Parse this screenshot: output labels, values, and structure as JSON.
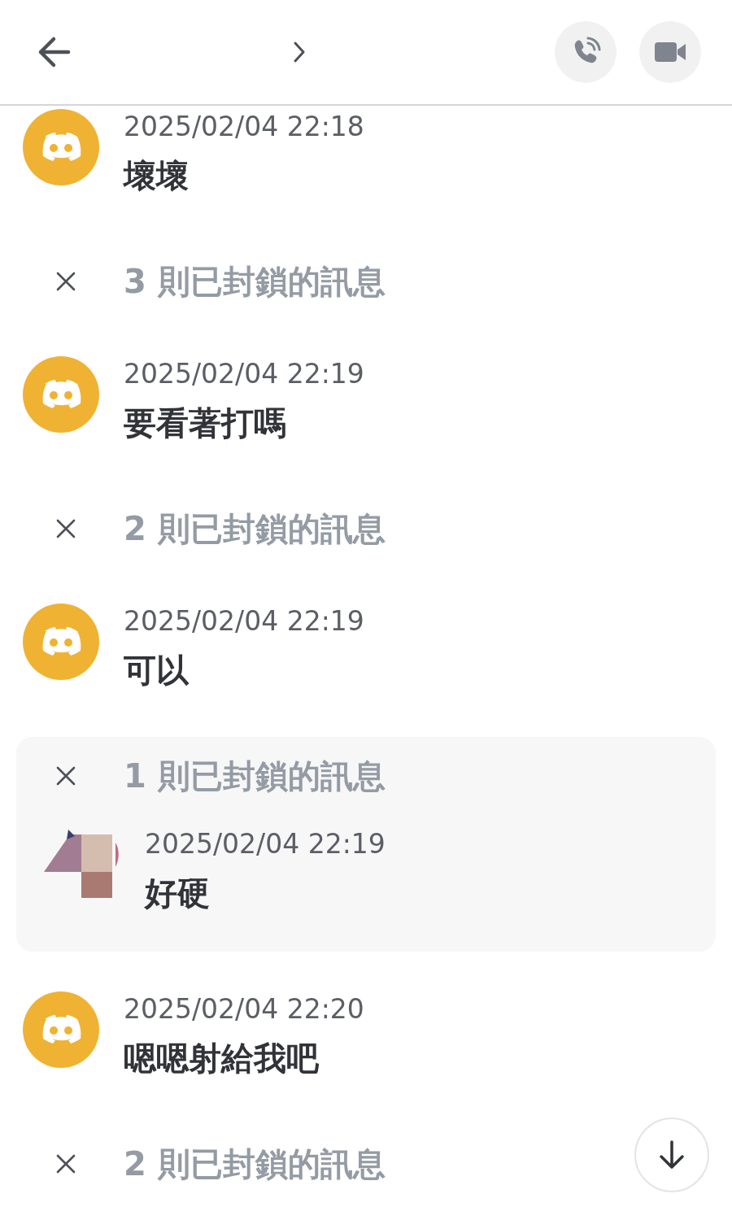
{
  "items": [
    {
      "kind": "message",
      "avatar": {
        "kind": "default"
      },
      "time": "2025/02/04 22:18",
      "text": "壞壞"
    },
    {
      "kind": "blocked",
      "label": "3 則已封鎖的訊息",
      "expanded": false
    },
    {
      "kind": "message",
      "avatar": {
        "kind": "default"
      },
      "time": "2025/02/04 22:19",
      "text": "要看著打嗎"
    },
    {
      "kind": "blocked",
      "label": "2 則已封鎖的訊息",
      "expanded": false
    },
    {
      "kind": "message",
      "avatar": {
        "kind": "default"
      },
      "time": "2025/02/04 22:19",
      "text": "可以"
    },
    {
      "kind": "blocked",
      "label": "1 則已封鎖的訊息",
      "expanded": true,
      "messages": [
        {
          "kind": "message",
          "time": "2025/02/04 22:19",
          "text": "好硬"
        }
      ]
    },
    {
      "kind": "message",
      "avatar": {
        "kind": "default"
      },
      "time": "2025/02/04 22:20",
      "text": "嗯嗯射給我吧"
    },
    {
      "kind": "blocked",
      "label": "2 則已封鎖的訊息",
      "expanded": false
    }
  ]
}
